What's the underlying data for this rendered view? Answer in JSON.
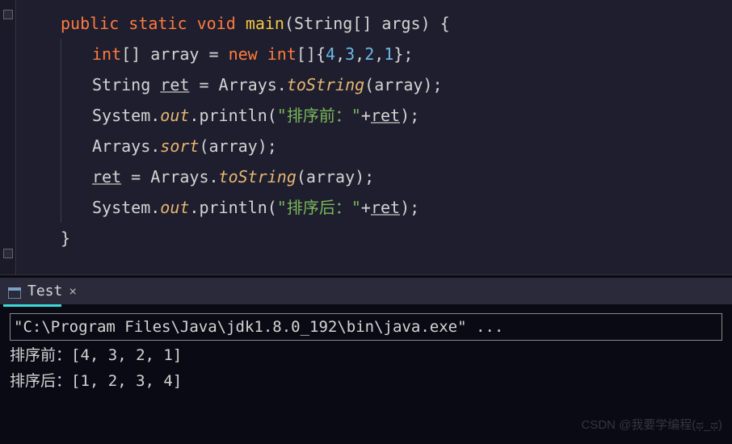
{
  "code": {
    "line1": {
      "public": "public",
      "static": "static",
      "void": "void",
      "main": "main",
      "paren_open": "(",
      "string_type": "String",
      "brackets": "[] ",
      "args": "args",
      "paren_close": ") ",
      "brace": "{"
    },
    "line2": {
      "int_kw": "int",
      "brackets": "[] ",
      "array": "array",
      "eq": " = ",
      "new_kw": "new",
      "int_kw2": " int",
      "brackets2": "[]{",
      "n1": "4",
      "c1": ",",
      "n2": "3",
      "c2": ",",
      "n3": "2",
      "c3": ",",
      "n4": "1",
      "close": "};"
    },
    "line3": {
      "string_type": "String ",
      "ret": "ret",
      "eq": " = ",
      "arrays": "Arrays.",
      "tostring": "toString",
      "paren": "(array);"
    },
    "line4": {
      "system": "System.",
      "out": "out",
      "println": ".println(",
      "str": "\"排序前：\"",
      "plus": "+",
      "ret": "ret",
      "close": ");"
    },
    "line5": {
      "arrays": "Arrays.",
      "sort": "sort",
      "paren": "(array);"
    },
    "line6": {
      "ret": "ret",
      "eq": " = ",
      "arrays": "Arrays.",
      "tostring": "toString",
      "paren": "(array);"
    },
    "line7": {
      "system": "System.",
      "out": "out",
      "println": ".println(",
      "str": "\"排序后：\"",
      "plus": "+",
      "ret": "ret",
      "close": ");"
    },
    "line8": {
      "brace": "}"
    }
  },
  "tab": {
    "name": "Test",
    "close": "×"
  },
  "console": {
    "cmd": "\"C:\\Program Files\\Java\\jdk1.8.0_192\\bin\\java.exe\" ...",
    "out1": "排序前：[4, 3, 2, 1]",
    "out2": "排序后：[1, 2, 3, 4]"
  },
  "watermark": "CSDN @我要学编程(ಥ_ಥ)"
}
